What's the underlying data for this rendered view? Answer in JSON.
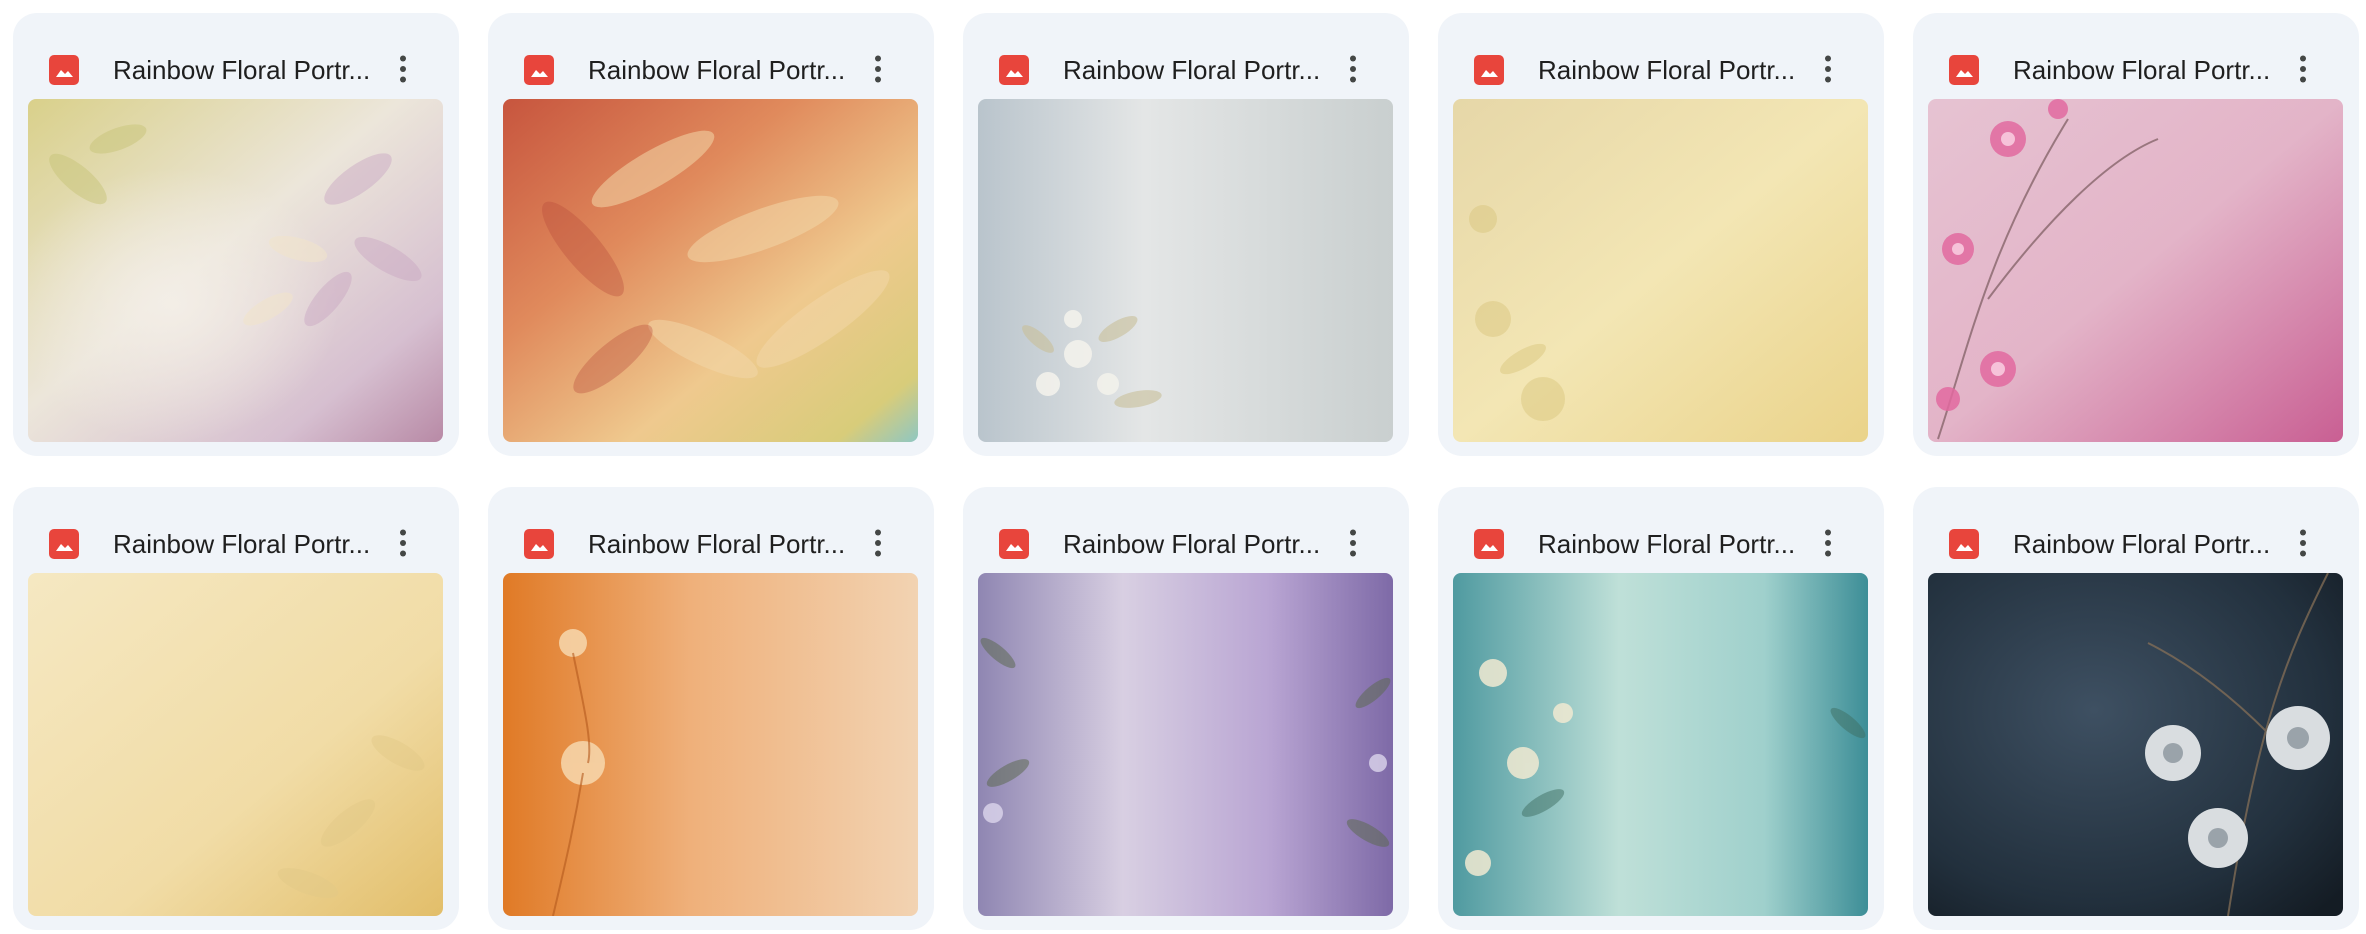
{
  "files": [
    {
      "title": "Rainbow Floral Portr...",
      "thumbnail": "pastel-floral-leaves-yellow-purple"
    },
    {
      "title": "Rainbow Floral Portr...",
      "thumbnail": "orange-red-feather-leaves"
    },
    {
      "title": "Rainbow Floral Portr...",
      "thumbnail": "pale-blue-grey-white-flowers"
    },
    {
      "title": "Rainbow Floral Portr...",
      "thumbnail": "pale-yellow-floral-texture"
    },
    {
      "title": "Rainbow Floral Portr...",
      "thumbnail": "pink-cherry-blossom-branches"
    },
    {
      "title": "Rainbow Floral Portr...",
      "thumbnail": "cream-yellow-leaves-texture"
    },
    {
      "title": "Rainbow Floral Portr...",
      "thumbnail": "orange-flower-texture"
    },
    {
      "title": "Rainbow Floral Portr...",
      "thumbnail": "lavender-purple-floral-edges"
    },
    {
      "title": "Rainbow Floral Portr...",
      "thumbnail": "teal-aqua-floral-edges"
    },
    {
      "title": "Rainbow Floral Portr...",
      "thumbnail": "dark-navy-white-peonies"
    }
  ],
  "icons": {
    "file_type": "image-file-icon",
    "menu": "more-vert-icon"
  },
  "colors": {
    "card_background": "#f0f4f9",
    "image_icon": "#e8453c",
    "title_text": "#1f1f1f"
  }
}
